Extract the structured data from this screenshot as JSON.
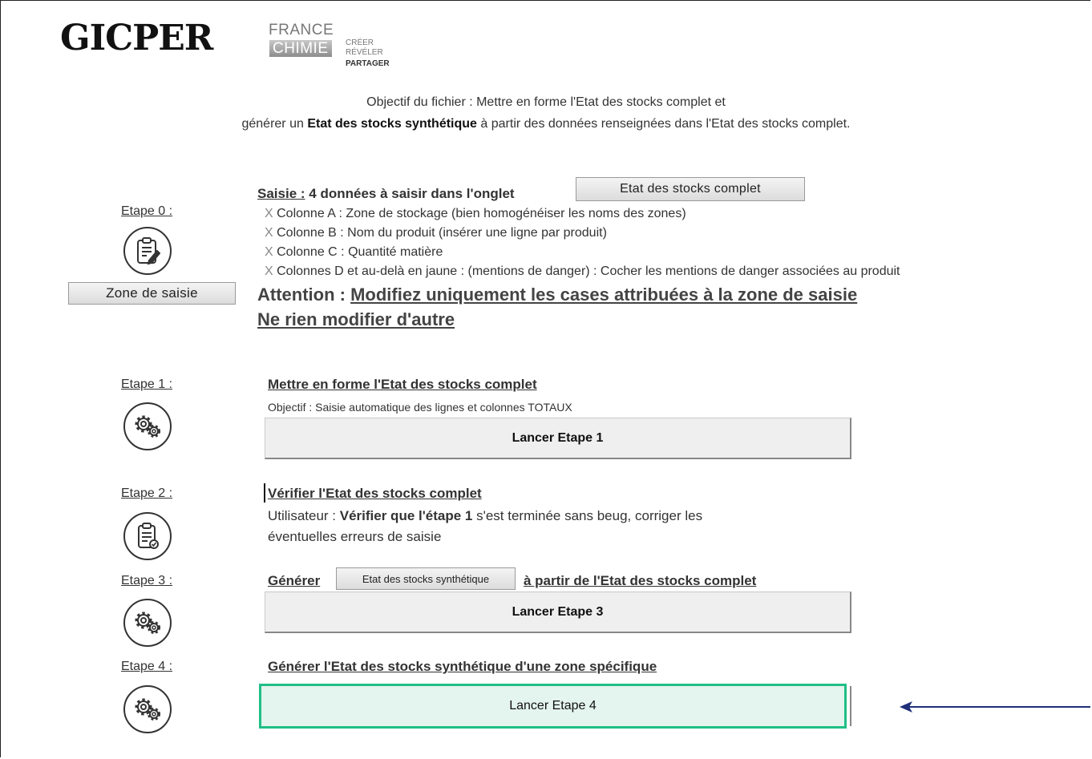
{
  "header": {
    "logo_text": "GICPER",
    "partner": {
      "line1": "FRANCE",
      "line2": "CHIMIE",
      "tag1": "CRÉER",
      "tag2": "RÉVÉLER",
      "tag3": "PARTAGER"
    }
  },
  "intro": {
    "line1": "Objectif du fichier : Mettre en forme l'Etat des stocks complet et",
    "line2_pre": "générer un ",
    "line2_bold": "Etat des stocks synthétique",
    "line2_post": " à partir des données renseignées dans l'Etat des stocks complet."
  },
  "step0": {
    "label": "Etape 0 :",
    "zone_button": "Zone de saisie",
    "heading_underlined": "Saisie :",
    "heading_rest": " 4 données à saisir dans l'onglet",
    "sheet_button": "Etat des stocks complet",
    "bullet_mark": "X",
    "bullets": [
      "Colonne A : Zone de stockage (bien homogénéiser les noms des zones)",
      "Colonne B : Nom du produit (insérer une ligne par produit)",
      "Colonne C : Quantité matière",
      "Colonnes D et au-delà en jaune : (mentions de danger) : Cocher les mentions de danger associées au produit"
    ],
    "attention_prefix": "Attention : ",
    "attention_text": "Modifiez uniquement les cases attribuées à la zone de saisie",
    "attention_line2": "Ne rien modifier d'autre"
  },
  "step1": {
    "label": "Etape 1 :",
    "heading": "Mettre en forme l'Etat des stocks complet",
    "objective": "Objectif : Saisie automatique des lignes et colonnes TOTAUX",
    "button": "Lancer Etape 1"
  },
  "step2": {
    "label": "Etape 2 :",
    "heading": "Vérifier l'Etat des stocks complet",
    "text_pre": "Utilisateur : ",
    "text_bold": "Vérifier que l'étape 1",
    "text_post": " s'est terminée sans beug, corriger les",
    "text_line2": "éventuelles erreurs de saisie"
  },
  "step3": {
    "label": "Etape 3 :",
    "heading_pre": "Générer",
    "sheet_button": "Etat des stocks synthétique",
    "heading_post": "à partir de l'Etat des stocks complet",
    "button": "Lancer Etape 3"
  },
  "step4": {
    "label": "Etape 4 :",
    "heading": "Générer l'Etat des stocks synthétique d'une zone spécifique",
    "button": "Lancer Etape 4"
  },
  "colors": {
    "highlight_border": "#1fbf86",
    "highlight_fill": "#e4f4ef",
    "arrow": "#1f2f7a"
  }
}
